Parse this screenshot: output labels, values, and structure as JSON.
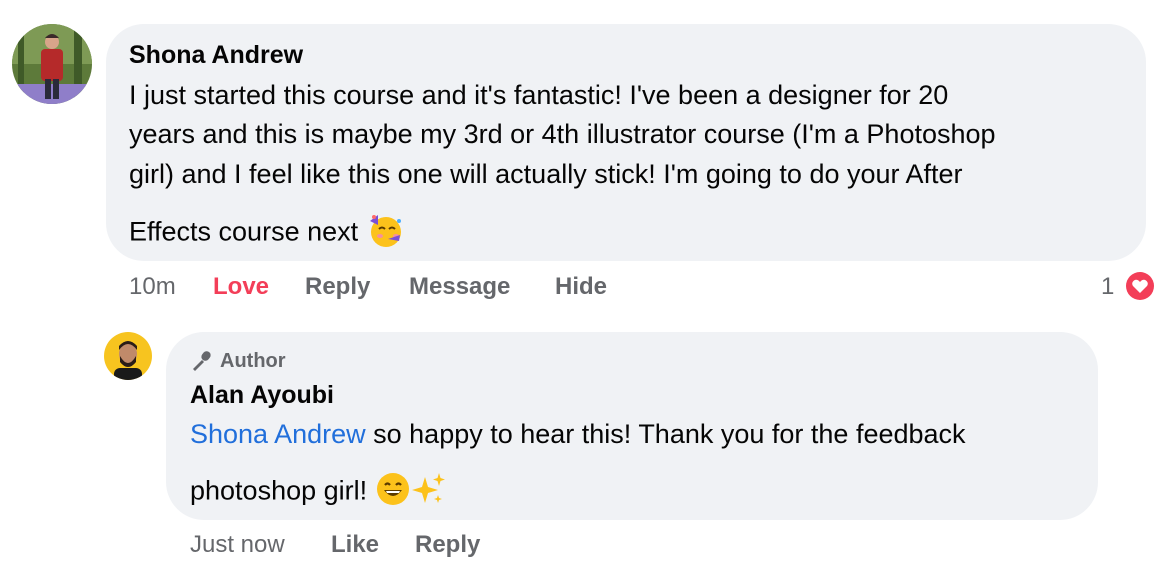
{
  "comment": {
    "author": "Shona Andrew",
    "lines": [
      "I just started this course and it's fantastic! I've been a designer for 20",
      "years and this is maybe my 3rd or 4th illustrator course (I'm a Photoshop",
      "girl) and I feel like this one will actually stick! I'm going to do your After",
      "Effects course next"
    ],
    "emoji": "party-face-icon",
    "time": "10m",
    "actions": {
      "love": "Love",
      "reply": "Reply",
      "message": "Message",
      "hide": "Hide"
    },
    "reaction_count": "1",
    "reaction_icon": "heart-icon",
    "colors": {
      "love": "#f33e58",
      "bubble": "#f0f2f5",
      "meta": "#65676b"
    }
  },
  "reply": {
    "badge": "Author",
    "author": "Alan Ayoubi",
    "mention": "Shona Andrew",
    "line1_rest": " so happy to hear this! Thank you for the feedback",
    "line2": "photoshop girl!",
    "emojis": [
      "grinning-face-icon",
      "sparkles-icon"
    ],
    "time": "Just now",
    "actions": {
      "like": "Like",
      "reply": "Reply"
    },
    "colors": {
      "mention": "#216fdb"
    }
  }
}
